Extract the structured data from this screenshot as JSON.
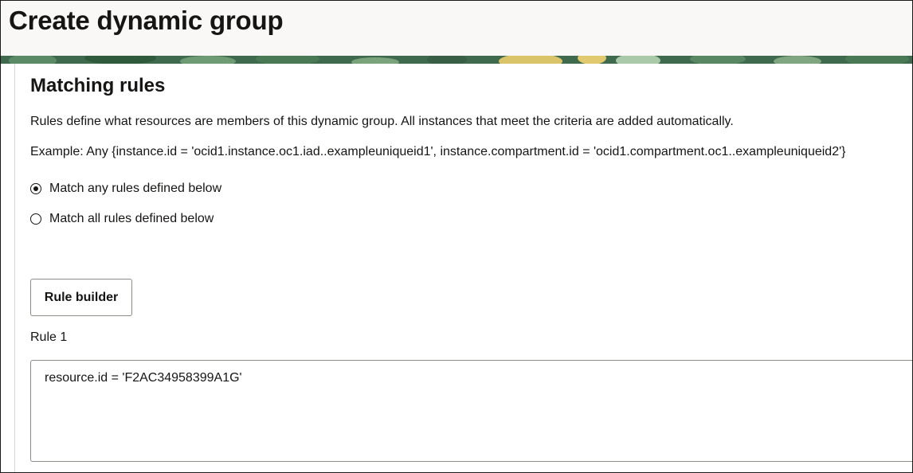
{
  "page": {
    "title": "Create dynamic group"
  },
  "matching_rules": {
    "heading": "Matching rules",
    "description": "Rules define what resources are members of this dynamic group. All instances that meet the criteria are added automatically.",
    "example": "Example: Any {instance.id = 'ocid1.instance.oc1.iad..exampleuniqueid1', instance.compartment.id = 'ocid1.compartment.oc1..exampleuniqueid2'}",
    "options": [
      {
        "label": "Match any rules defined below",
        "selected": true
      },
      {
        "label": "Match all rules defined below",
        "selected": false
      }
    ],
    "rule_builder_label": "Rule builder",
    "rules": [
      {
        "label": "Rule 1",
        "value": "resource.id = 'F2AC34958399A1G'"
      }
    ]
  },
  "colors": {
    "banner_base": "#3f6a4d",
    "header_bg": "#f9f8f6",
    "text": "#161513"
  }
}
